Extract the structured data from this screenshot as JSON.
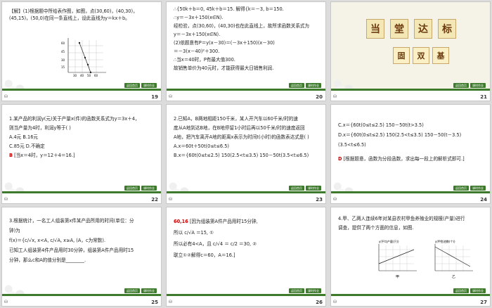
{
  "slides": [
    {
      "number": "19",
      "lines": [
        "【解】(1)根据题中所给表作图，如图，点(30,60)，(40,30)，",
        "(45,15)，(50,0)在同一条直线上，设此直线为y＝kx＋b。"
      ],
      "graph_y_ticks": [
        "60",
        "45",
        "30",
        "15"
      ],
      "graph_x_ticks": [
        "30",
        "40",
        "50",
        "60"
      ]
    },
    {
      "number": "20",
      "lines": [
        "∴{50k＋b＝0,  45k＋b＝15.   解得{k＝－3, b＝150.",
        "∴y＝－3x＋150(x∈N).",
        "经检验，点(30,60)，(40,30)也在此直线上，故所求函数关系式为",
        "y＝－3x＋150(x∈N).",
        "(2)依题意有P＝y(x－30)＝(－3x＋150)(x－30)",
        "＝－3(x－40)²＋300.",
        "∴当x＝40时，P有最大值300.",
        "故销售单价为40元时，才能获得最大日销售利润."
      ]
    },
    {
      "number": "21",
      "title_chars": [
        "当",
        "堂",
        "达",
        "标"
      ],
      "sub_chars": [
        "固",
        "双",
        "基"
      ]
    },
    {
      "number": "22",
      "lines": [
        "1.某产品的利润y(元)关于产量x(件)的函数关系式为y＝3x＋4，",
        "则当产量为4时，利润y等于(    )",
        "A.4元            B.16元",
        "C.85元           D.不确定"
      ],
      "answer": "B",
      "answer_text": "[当x＝4时，y＝12＋4＝16.]"
    },
    {
      "number": "23",
      "lines": [
        "2.已知A，B两地相距150千米，某人开汽车以60千米/时的速",
        "度从A地到达B地，在B地停留1小时后再以50千米/时的速度返回",
        "A地，把汽车离开A地的距离x表示为时间t(小时)的函数表达式是(   )",
        "A.x＝60t＋50t(0≤t≤6.5)",
        "B.x＝{60t(0≤t≤2.5)  150(2.5<t≤3.5)  150－50t(3.5<t≤6.5)"
      ]
    },
    {
      "number": "24",
      "lines": [
        "C.x＝{60t(0≤t≤2.5)  150－50t(t>3.5)",
        "D.x＝{60t(0≤t≤2.5)  150(2.5<t≤3.5)  150－50(t－3.5)(3.5<t≤6.5)"
      ],
      "answer": "D",
      "answer_text": "[根据题意，函数为分段函数，求出每一段上的解析式即可.]"
    },
    {
      "number": "25",
      "lines": [
        "3.根据统计，一名工人组装第x件某产品所用的时间(单位：分",
        "钟)为",
        "f(x)＝{c/√x, x<A,  c/√A, x≥A,   (A，c为常数).",
        "已知工人组装第4件产品用时30分钟，组装第A件产品用时15",
        "分钟，那么c和A的值分别是________."
      ]
    },
    {
      "number": "26",
      "answer": "60,16",
      "lines": [
        "[因为组装第A件产品用时15分钟,",
        "所以 c/√A ＝15,                     ①",
        "所以必有4<A，且 c/√4 ＝ c/2 ＝30,   ②",
        "联立①②解得c＝60，A＝16.]"
      ]
    },
    {
      "number": "27",
      "lines": [
        "4.甲、乙两人连续6年对某县农村甲鱼养殖业的规模(产量)进行",
        "调查，提供了两个方面的信息，如图."
      ],
      "chart1_ylabel": "y(平均产量(只))",
      "chart2_ylabel": "y(甲鱼池数(个))",
      "chart_xlabel": "甲",
      "chart2_xlabel": "乙"
    }
  ],
  "nav": {
    "prev_label": "返回首页",
    "next_label": "课时作业"
  }
}
